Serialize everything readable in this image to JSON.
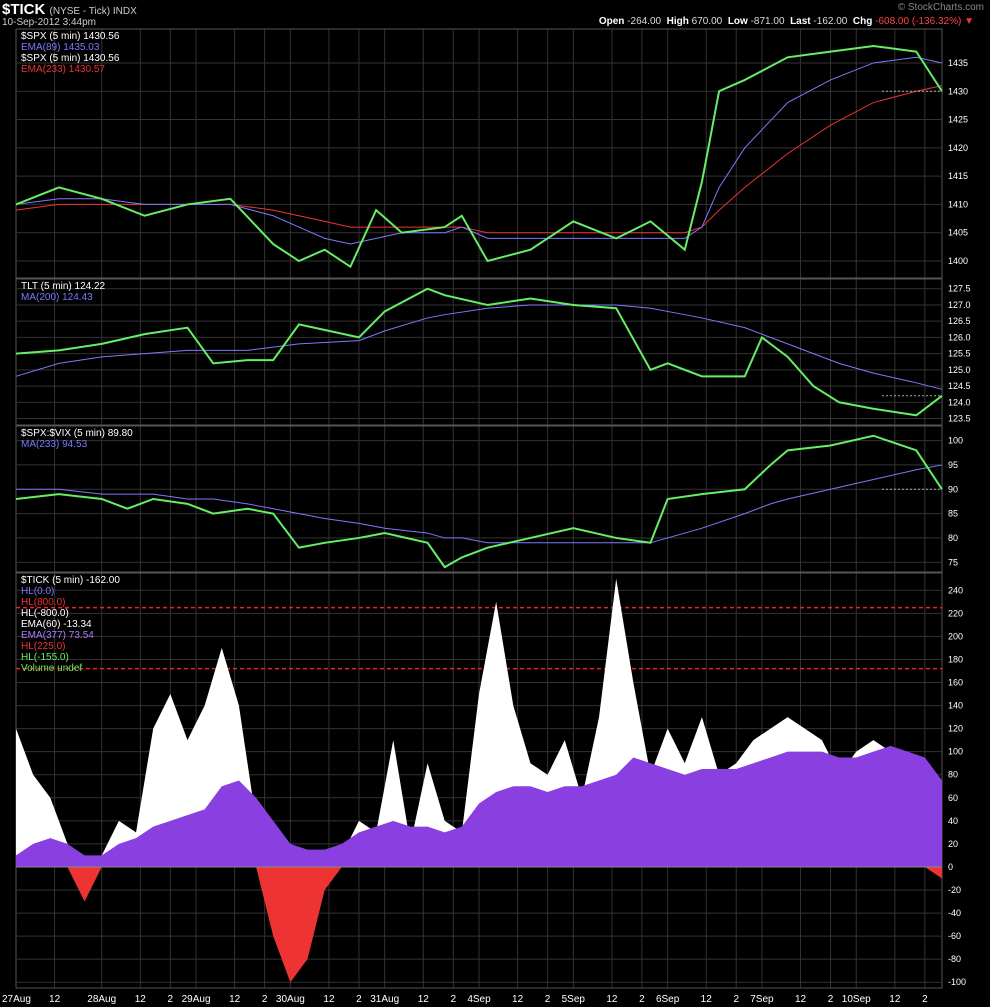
{
  "header": {
    "ticker": "$TICK",
    "exchange": "(NYSE - Tick) INDX",
    "datetime": "10-Sep-2012 3:44pm",
    "open_label": "Open",
    "open": "-264.00",
    "high_label": "High",
    "high": "670.00",
    "low_label": "Low",
    "low": "-871.00",
    "last_label": "Last",
    "last": "-162.00",
    "chg_label": "Chg",
    "chg": "-608.00 (-136.32%)",
    "watermark": "© StockCharts.com"
  },
  "colors": {
    "green": "#66ee66",
    "blue": "#7a7aff",
    "red": "#ee3333",
    "white": "#ffffff",
    "purple": "#8a3fe0",
    "grid": "#333333"
  },
  "chart_data": [
    {
      "type": "line",
      "panel": "SPX",
      "legend": [
        "$SPX (5 min) 1430.56",
        "EMA(89) 1435.03",
        "$SPX (5 min) 1430.56",
        "EMA(233) 1430.57"
      ],
      "ylim": [
        1397,
        1441
      ],
      "yticks": [
        1400,
        1405,
        1410,
        1415,
        1420,
        1425,
        1430,
        1435
      ],
      "x": [
        0,
        0.5,
        1,
        1.5,
        2,
        2.5,
        3,
        3.3,
        3.6,
        3.9,
        4.2,
        4.5,
        5,
        5.2,
        5.5,
        6,
        6.5,
        7,
        7.4,
        7.8,
        8,
        8.2,
        8.5,
        9,
        9.5,
        10,
        10.5,
        10.8
      ],
      "series": [
        {
          "name": "$SPX (5 min)",
          "color": "#66ee66",
          "values": [
            1410,
            1413,
            1411,
            1408,
            1410,
            1411,
            1403,
            1400,
            1402,
            1399,
            1409,
            1405,
            1406,
            1408,
            1400,
            1402,
            1407,
            1404,
            1407,
            1402,
            1414,
            1430,
            1432,
            1436,
            1437,
            1438,
            1437,
            1430
          ]
        },
        {
          "name": "EMA(89)",
          "color": "#7a7aff",
          "values": [
            1410,
            1411,
            1411,
            1410,
            1410,
            1410,
            1408,
            1406,
            1404,
            1403,
            1404,
            1405,
            1405,
            1406,
            1404,
            1404,
            1404,
            1404,
            1404,
            1404,
            1406,
            1413,
            1420,
            1428,
            1432,
            1435,
            1436,
            1435
          ]
        },
        {
          "name": "EMA(233)",
          "color": "#ee3333",
          "values": [
            1409,
            1410,
            1410,
            1410,
            1410,
            1410,
            1409,
            1408,
            1407,
            1406,
            1406,
            1406,
            1406,
            1406,
            1405,
            1405,
            1405,
            1405,
            1405,
            1405,
            1406,
            1409,
            1413,
            1419,
            1424,
            1428,
            1430,
            1431
          ]
        }
      ]
    },
    {
      "type": "line",
      "panel": "TLT",
      "legend": [
        "TLT (5 min) 124.22",
        "MA(200) 124.43"
      ],
      "ylim": [
        123.3,
        127.8
      ],
      "yticks": [
        123.5,
        124.0,
        124.5,
        125.0,
        125.5,
        126.0,
        126.5,
        127.0,
        127.5
      ],
      "x": [
        0,
        0.5,
        1,
        1.5,
        2,
        2.3,
        2.7,
        3,
        3.3,
        4,
        4.3,
        4.8,
        5,
        5.5,
        6,
        6.5,
        7,
        7.4,
        7.6,
        8,
        8.5,
        8.7,
        9,
        9.3,
        9.6,
        10,
        10.5,
        10.8
      ],
      "series": [
        {
          "name": "TLT (5 min)",
          "color": "#66ee66",
          "values": [
            125.5,
            125.6,
            125.8,
            126.1,
            126.3,
            125.2,
            125.3,
            125.3,
            126.4,
            126.0,
            126.8,
            127.5,
            127.3,
            127.0,
            127.2,
            127.0,
            126.9,
            125.0,
            125.2,
            124.8,
            124.8,
            126.0,
            125.4,
            124.5,
            124.0,
            123.8,
            123.6,
            124.2
          ]
        },
        {
          "name": "MA(200)",
          "color": "#7a7aff",
          "values": [
            124.8,
            125.2,
            125.4,
            125.5,
            125.6,
            125.6,
            125.6,
            125.7,
            125.8,
            125.9,
            126.2,
            126.6,
            126.7,
            126.9,
            127.0,
            127.0,
            127.0,
            126.9,
            126.8,
            126.6,
            126.3,
            126.1,
            125.8,
            125.5,
            125.2,
            124.9,
            124.6,
            124.4
          ]
        }
      ]
    },
    {
      "type": "line",
      "panel": "SPX:VIX",
      "legend": [
        "$SPX:$VIX (5 min) 89.80",
        "MA(233) 94.53"
      ],
      "ylim": [
        73,
        103
      ],
      "yticks": [
        75,
        80,
        85,
        90,
        95,
        100
      ],
      "x": [
        0,
        0.5,
        1,
        1.3,
        1.6,
        2,
        2.3,
        2.7,
        3,
        3.3,
        3.6,
        4,
        4.3,
        4.8,
        5,
        5.2,
        5.5,
        6,
        6.5,
        7,
        7.4,
        7.6,
        8,
        8.5,
        8.8,
        9,
        9.5,
        10,
        10.5,
        10.8
      ],
      "series": [
        {
          "name": "$SPX:$VIX (5 min)",
          "color": "#66ee66",
          "values": [
            88,
            89,
            88,
            86,
            88,
            87,
            85,
            86,
            85,
            78,
            79,
            80,
            81,
            79,
            74,
            76,
            78,
            80,
            82,
            80,
            79,
            88,
            89,
            90,
            95,
            98,
            99,
            101,
            98,
            90
          ]
        },
        {
          "name": "MA(233)",
          "color": "#7a7aff",
          "values": [
            90,
            90,
            89,
            89,
            89,
            88,
            88,
            87,
            86,
            85,
            84,
            83,
            82,
            81,
            80,
            80,
            79,
            79,
            79,
            79,
            79,
            80,
            82,
            85,
            87,
            88,
            90,
            92,
            94,
            95
          ]
        }
      ]
    },
    {
      "type": "area",
      "panel": "TICK",
      "legend": [
        "$TICK (5 min) -162.00",
        "HL(0.0)",
        "HL(800.0)",
        "HL(-800.0)",
        "EMA(60) -13.34",
        "EMA(377) 73.54",
        "HL(225.0)",
        "HL(-155.0)",
        "Volume undef"
      ],
      "ylim": [
        -105,
        255
      ],
      "yticks": [
        -100,
        -80,
        -60,
        -40,
        -20,
        0,
        20,
        40,
        60,
        80,
        100,
        120,
        140,
        160,
        180,
        200,
        220,
        240
      ],
      "hlines": [
        225,
        172
      ],
      "x": [
        0,
        0.2,
        0.4,
        0.6,
        0.8,
        1,
        1.2,
        1.4,
        1.6,
        1.8,
        2,
        2.2,
        2.4,
        2.6,
        2.8,
        3,
        3.2,
        3.4,
        3.6,
        3.8,
        4,
        4.2,
        4.4,
        4.6,
        4.8,
        5,
        5.2,
        5.4,
        5.6,
        5.8,
        6,
        6.2,
        6.4,
        6.6,
        6.8,
        7,
        7.2,
        7.4,
        7.6,
        7.8,
        8,
        8.2,
        8.4,
        8.6,
        8.8,
        9,
        9.2,
        9.4,
        9.6,
        9.8,
        10,
        10.2,
        10.4,
        10.6,
        10.8
      ],
      "series": [
        {
          "name": "EMA(60)",
          "color": "#ffffff",
          "values": [
            120,
            80,
            60,
            20,
            -30,
            10,
            40,
            30,
            120,
            150,
            110,
            140,
            190,
            140,
            40,
            -60,
            -100,
            -80,
            -20,
            10,
            40,
            30,
            110,
            20,
            90,
            40,
            30,
            150,
            230,
            140,
            90,
            80,
            110,
            60,
            130,
            250,
            160,
            80,
            120,
            90,
            130,
            80,
            90,
            110,
            120,
            130,
            120,
            110,
            80,
            100,
            110,
            100,
            90,
            80,
            -10
          ]
        },
        {
          "name": "EMA(377)",
          "color": "#8a3fe0",
          "values": [
            10,
            20,
            25,
            20,
            10,
            10,
            20,
            25,
            35,
            40,
            45,
            50,
            70,
            75,
            60,
            40,
            20,
            15,
            15,
            20,
            30,
            35,
            40,
            35,
            35,
            30,
            35,
            55,
            65,
            70,
            70,
            65,
            70,
            70,
            75,
            80,
            95,
            90,
            85,
            80,
            85,
            85,
            85,
            90,
            95,
            100,
            100,
            100,
            95,
            95,
            100,
            105,
            100,
            95,
            75
          ]
        }
      ]
    }
  ],
  "xaxis": {
    "labels": [
      "27Aug",
      "12",
      "28Aug",
      "12",
      "2",
      "29Aug",
      "12",
      "2",
      "30Aug",
      "12",
      "2",
      "31Aug",
      "12",
      "2",
      "4Sep",
      "12",
      "2",
      "5Sep",
      "12",
      "2",
      "6Sep",
      "12",
      "2",
      "7Sep",
      "12",
      "2",
      "10Sep",
      "12",
      "2"
    ],
    "positions": [
      0,
      0.45,
      1,
      1.45,
      1.8,
      2.1,
      2.55,
      2.9,
      3.2,
      3.65,
      4,
      4.3,
      4.75,
      5.1,
      5.4,
      5.85,
      6.2,
      6.5,
      6.95,
      7.3,
      7.6,
      8.05,
      8.4,
      8.7,
      9.15,
      9.5,
      9.8,
      10.25,
      10.6
    ]
  }
}
